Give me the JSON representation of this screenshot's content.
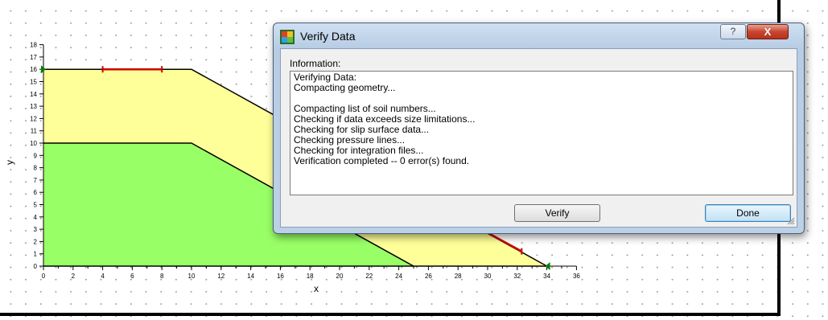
{
  "plot": {
    "x_axis_label": "x",
    "y_axis_label": "y",
    "x_ticks": [
      "0",
      "2",
      "4",
      "6",
      "8",
      "10",
      "12",
      "14",
      "16",
      "18",
      "20",
      "22",
      "24",
      "26",
      "28",
      "30",
      "32",
      "34",
      "36"
    ],
    "y_ticks": [
      "0",
      "1",
      "2",
      "3",
      "4",
      "5",
      "6",
      "7",
      "8",
      "9",
      "10",
      "11",
      "12",
      "13",
      "14",
      "15",
      "16",
      "17",
      "18"
    ],
    "colors": {
      "upper_soil": "#ffff99",
      "lower_soil": "#99ff66",
      "boundary": "#000000",
      "limit_marker": "#cc0000",
      "pin_marker": "#008000"
    },
    "upper_region_points": [
      [
        0,
        0
      ],
      [
        0,
        16
      ],
      [
        10,
        16
      ],
      [
        34,
        0
      ]
    ],
    "lower_region_points": [
      [
        0,
        0
      ],
      [
        0,
        10
      ],
      [
        10,
        10
      ],
      [
        25,
        0
      ]
    ],
    "surface_line": [
      [
        0,
        16
      ],
      [
        10,
        16
      ],
      [
        34,
        0
      ]
    ],
    "interface_line": [
      [
        0,
        10
      ],
      [
        10,
        10
      ],
      [
        25,
        0
      ]
    ],
    "left_limit_segment": [
      [
        4,
        16
      ],
      [
        8,
        16
      ]
    ],
    "right_limit_segment": [
      [
        28.5,
        3.7
      ],
      [
        32.3,
        1.2
      ]
    ],
    "pins": [
      [
        0,
        16
      ],
      [
        34,
        0
      ]
    ]
  },
  "dialog": {
    "title": "Verify Data",
    "icon": "geoslope-app-icon",
    "help_label": "?",
    "close_label": "X",
    "info_label": "Information:",
    "lines": [
      "Verifying Data:",
      "Compacting geometry...",
      "",
      "Compacting list of soil numbers...",
      "Checking if data exceeds size limitations...",
      "Checking for slip surface data...",
      "Checking pressure lines...",
      "Checking for integration files...",
      "Verification completed -- 0 error(s) found."
    ],
    "verify_button": "Verify",
    "done_button": "Done"
  }
}
